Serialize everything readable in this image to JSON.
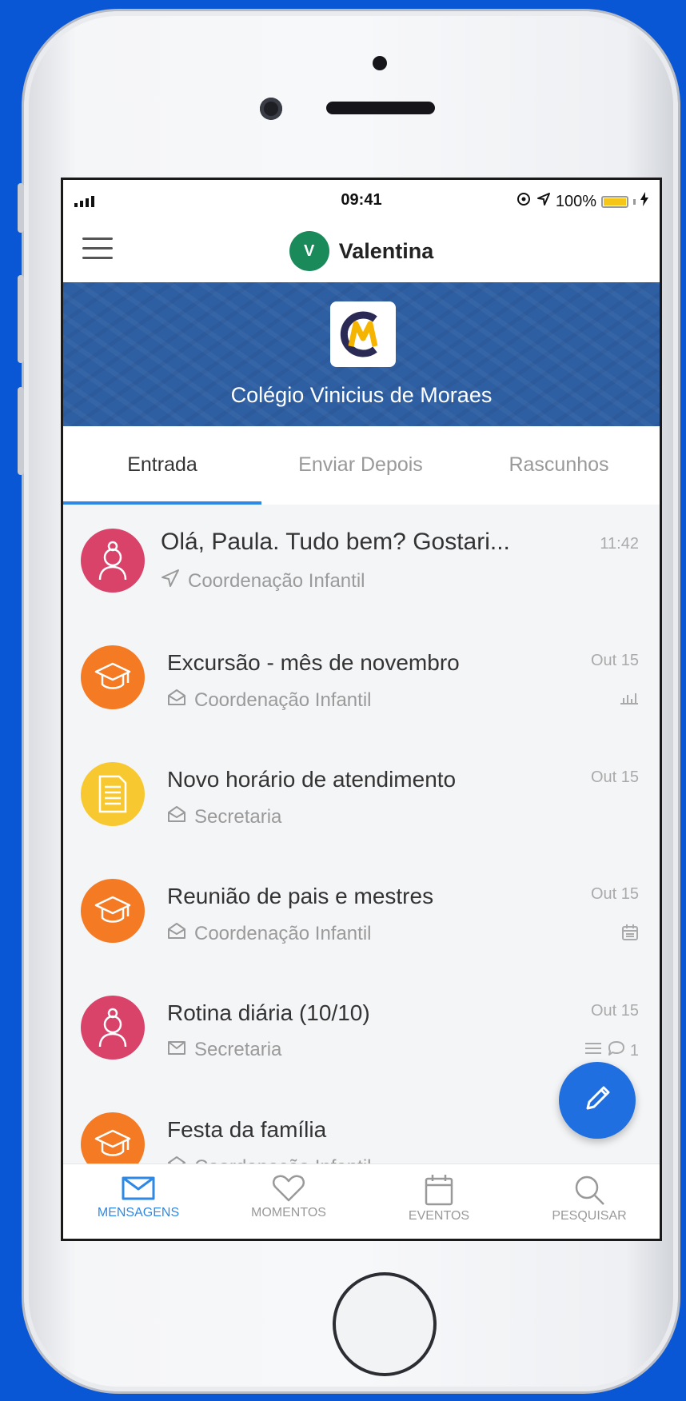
{
  "status": {
    "time": "09:41",
    "battery": "100%"
  },
  "header": {
    "avatar_letter": "V",
    "user_name": "Valentina"
  },
  "banner": {
    "school_name": "Colégio Vinicius de Moraes"
  },
  "tabs": [
    {
      "label": "Entrada",
      "active": true
    },
    {
      "label": "Enviar Depois",
      "active": false
    },
    {
      "label": "Rascunhos",
      "active": false
    }
  ],
  "messages": [
    {
      "title": "Olá, Paula. Tudo bem? Gostari...",
      "sender": "Coordenação Infantil",
      "time": "11:42",
      "avatar": "teacher-icon",
      "sub_icon": "send-icon"
    },
    {
      "title": "Excursão - mês de novembro",
      "sender": "Coordenação Infantil",
      "time": "Out 15",
      "avatar": "graduation-cap-icon",
      "sub_icon": "envelope-open-icon",
      "meta": "chart-icon"
    },
    {
      "title": "Novo horário de atendimento",
      "sender": "Secretaria",
      "time": "Out 15",
      "avatar": "document-icon",
      "sub_icon": "envelope-open-icon"
    },
    {
      "title": "Reunião de pais e mestres",
      "sender": "Coordenação Infantil",
      "time": "Out 15",
      "avatar": "graduation-cap-icon",
      "sub_icon": "envelope-open-icon",
      "meta": "calendar-icon"
    },
    {
      "title": "Rotina diária (10/10)",
      "sender": "Secretaria",
      "time": "Out 15",
      "avatar": "teacher-icon",
      "sub_icon": "envelope-icon",
      "meta": "list-icon",
      "comment_count": "1"
    },
    {
      "title": "Festa da família",
      "sender": "Coordenação Infantil",
      "time": "",
      "avatar": "graduation-cap-icon",
      "sub_icon": "envelope-open-icon"
    }
  ],
  "bottom_nav": [
    {
      "label": "MENSAGENS",
      "icon": "envelope-icon",
      "active": true
    },
    {
      "label": "MOMENTOS",
      "icon": "heart-icon",
      "active": false
    },
    {
      "label": "EVENTOS",
      "icon": "calendar-icon",
      "active": false
    },
    {
      "label": "PESQUISAR",
      "icon": "search-icon",
      "active": false
    }
  ],
  "colors": {
    "accent": "#2e88e6",
    "banner": "#2e5fa3",
    "avatar_red": "#d9436a",
    "avatar_orange": "#f47a24",
    "avatar_yellow": "#f8c830",
    "fab": "#1f6fe0"
  }
}
